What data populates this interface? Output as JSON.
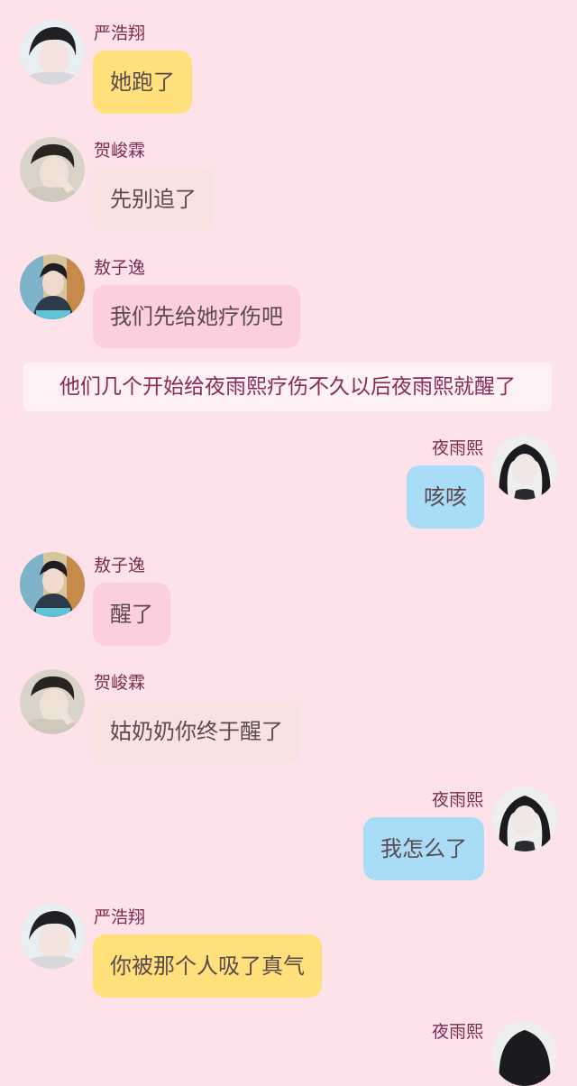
{
  "messages": [
    {
      "side": "left",
      "speaker": "严浩翔",
      "avatar": "avatar-yan",
      "text": "她跑了",
      "color": "#ffe07a"
    },
    {
      "side": "left",
      "speaker": "贺峻霖",
      "avatar": "avatar-he",
      "text": "先别追了",
      "color": "#f8e3e1"
    },
    {
      "side": "left",
      "speaker": "敖子逸",
      "avatar": "avatar-ao",
      "text": "我们先给她疗伤吧",
      "color": "#fccfdc"
    },
    {
      "side": "right",
      "speaker": "夜雨熙",
      "avatar": "avatar-ye",
      "text": "咳咳",
      "color": "#a9dcf6"
    },
    {
      "side": "left",
      "speaker": "敖子逸",
      "avatar": "avatar-ao",
      "text": "醒了",
      "color": "#fccfdc"
    },
    {
      "side": "left",
      "speaker": "贺峻霖",
      "avatar": "avatar-he",
      "text": "姑奶奶你终于醒了",
      "color": "#f8e3e1"
    },
    {
      "side": "right",
      "speaker": "夜雨熙",
      "avatar": "avatar-ye",
      "text": "我怎么了",
      "color": "#a9dcf6"
    },
    {
      "side": "left",
      "speaker": "严浩翔",
      "avatar": "avatar-yan",
      "text": "你被那个人吸了真气",
      "color": "#ffe07a"
    }
  ],
  "narration": "他们几个开始给夜雨熙疗伤不久以后夜雨熙就醒了",
  "partial_next": {
    "speaker": "夜雨熙"
  }
}
